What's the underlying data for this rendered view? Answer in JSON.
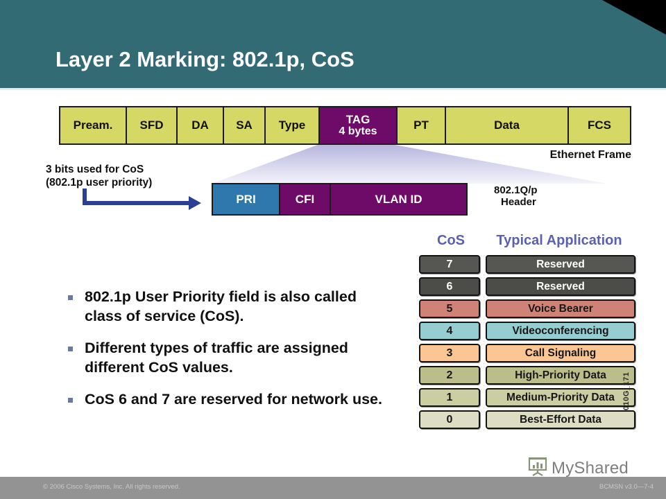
{
  "header": {
    "title": "Layer 2 Marking: 802.1p, CoS",
    "background_color": "#336b75",
    "title_color": "#ffffff"
  },
  "ethernet_frame": {
    "label": "Ethernet Frame",
    "cells": [
      {
        "label": "Pream.",
        "width": 96,
        "type": "normal"
      },
      {
        "label": "SFD",
        "width": 73,
        "type": "normal"
      },
      {
        "label": "DA",
        "width": 67,
        "type": "normal"
      },
      {
        "label": "SA",
        "width": 60,
        "type": "normal"
      },
      {
        "label": "Type",
        "width": 78,
        "type": "normal"
      },
      {
        "label": "TAG",
        "label2": "4 bytes",
        "width": 112,
        "type": "tag"
      },
      {
        "label": "PT",
        "width": 70,
        "type": "normal"
      },
      {
        "label": "Data",
        "width": 177,
        "type": "normal"
      },
      {
        "label": "FCS",
        "width": 88,
        "type": "normal"
      }
    ],
    "cell_color": "#d6d865",
    "tag_color": "#6e0a68"
  },
  "qp_header": {
    "label_line1": "802.1Q/p",
    "label_line2": "Header",
    "cells": [
      {
        "label": "PRI",
        "width": 97,
        "color": "#2f78ad"
      },
      {
        "label": "CFI",
        "width": 73,
        "color": "#6e0a68"
      },
      {
        "label": "VLAN ID",
        "width": 195,
        "color": "#6e0a68"
      }
    ]
  },
  "annotation": {
    "line1": "3 bits used for CoS",
    "line2": "(802.1p user priority)",
    "arrow_color": "#2b3f97"
  },
  "bullets": [
    "802.1p User Priority field is also called class of service (CoS).",
    "Different types of traffic are assigned different CoS values.",
    "CoS 6 and 7 are reserved for network use."
  ],
  "cos_table": {
    "header_cos": "CoS",
    "header_application": "Typical Application",
    "header_color": "#5b60b0",
    "rows": [
      {
        "cos": "7",
        "application": "Reserved",
        "bg": "#565652",
        "fg": "#ffffff"
      },
      {
        "cos": "6",
        "application": "Reserved",
        "bg": "#4c4c49",
        "fg": "#ffffff"
      },
      {
        "cos": "5",
        "application": "Voice Bearer",
        "bg": "#cf8377",
        "fg": "#171717"
      },
      {
        "cos": "4",
        "application": "Videoconferencing",
        "bg": "#96cdd1",
        "fg": "#171717"
      },
      {
        "cos": "3",
        "application": "Call Signaling",
        "bg": "#f9c694",
        "fg": "#171717"
      },
      {
        "cos": "2",
        "application": "High-Priority Data",
        "bg": "#bbbe8a",
        "fg": "#171717"
      },
      {
        "cos": "1",
        "application": "Medium-Priority Data",
        "bg": "#cbcda2",
        "fg": "#171717"
      },
      {
        "cos": "0",
        "application": "Best-Effort Data",
        "bg": "#dcddc2",
        "fg": "#171717"
      }
    ]
  },
  "doc_code": "010G_171",
  "watermark": {
    "text": "MyShared",
    "icon": "presentation-easel-icon"
  },
  "footer": {
    "copyright": "© 2006 Cisco Systems, Inc. All rights reserved.",
    "course_code": "BCMSN v3.0—7-4",
    "background_color": "#939393"
  }
}
